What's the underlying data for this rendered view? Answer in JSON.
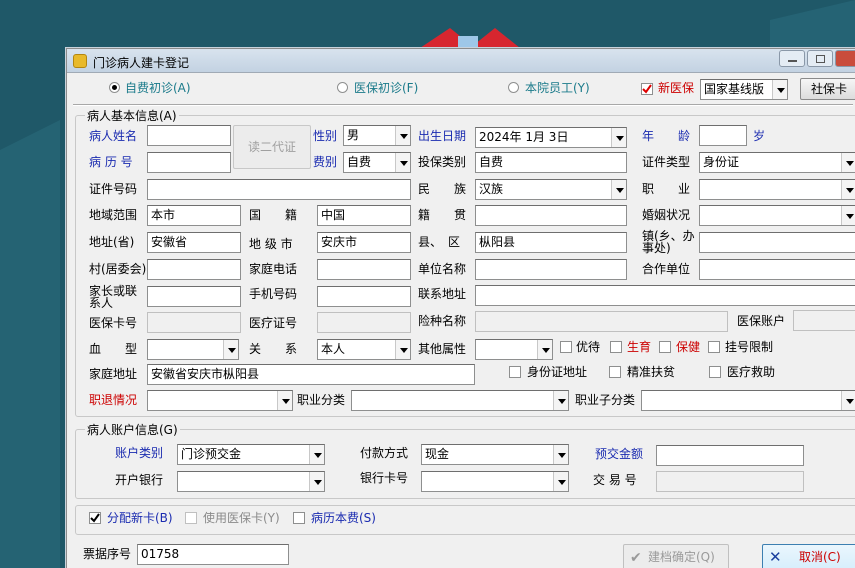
{
  "window": {
    "title": "门诊病人建卡登记"
  },
  "top": {
    "visit_self": "自费初诊(A)",
    "visit_insurance": "医保初诊(F)",
    "visit_staff": "本院员工(Y)",
    "new_insurance_label": "新医保",
    "insurance_version": "国家基线版",
    "social_card_btn": "社保卡"
  },
  "basic": {
    "group_title": "病人基本信息(A)",
    "read_id_btn": "读二代证",
    "name_label": "病人姓名",
    "gender_label": "性别",
    "gender_value": "男",
    "birth_label": "出生日期",
    "birth_value": "2024年 1月 3日",
    "age_label": "年　　龄",
    "age_unit": "岁",
    "record_label": "病 历 号",
    "fee_label": "费别",
    "fee_value": "自费",
    "insure_type_label": "投保类别",
    "insure_type_value": "自费",
    "cert_type_label": "证件类型",
    "cert_type_value": "身份证",
    "cert_no_label": "证件号码",
    "ethnic_label": "民　　族",
    "ethnic_value": "汉族",
    "job_label": "职　　业",
    "region_label": "地域范围",
    "region_value": "本市",
    "nation_label": "国　　籍",
    "nation_value": "中国",
    "origin_label": "籍　　贯",
    "marriage_label": "婚姻状况",
    "province_label": "地址(省)",
    "province_value": "安徽省",
    "city_label": "地 级 市",
    "city_value": "安庆市",
    "county_label": "县、　区",
    "county_value": "枞阳县",
    "town_label": "镇(乡、办事处)",
    "village_label": "村(居委会)",
    "home_phone_label": "家庭电话",
    "work_name_label": "单位名称",
    "coop_label": "合作单位",
    "guardian_label": "家长或联系人",
    "mobile_label": "手机号码",
    "contact_addr_label": "联系地址",
    "ins_card_label": "医保卡号",
    "medical_cert_label": "医疗证号",
    "ins_type_name_label": "险种名称",
    "ins_account_label": "医保账户",
    "blood_label": "血　　型",
    "relation_label": "关　　系",
    "relation_value": "本人",
    "other_attr_label": "其他属性",
    "preferential_label": "优待",
    "birth_ins_label": "生育",
    "health_label": "保健",
    "limit_label": "挂号限制",
    "home_addr_label": "家庭地址",
    "home_addr_value": "安徽省安庆市枞阳县",
    "id_addr_label": "身份证地址",
    "poverty_label": "精准扶贫",
    "aid_label": "医疗救助",
    "retire_label": "职退情况",
    "job_class_label": "职业分类",
    "job_subclass_label": "职业子分类"
  },
  "account": {
    "group_title": "病人账户信息(G)",
    "type_label": "账户类别",
    "type_value": "门诊预交金",
    "pay_label": "付款方式",
    "pay_value": "现金",
    "prepay_label": "预交金额",
    "bank_label": "开户银行",
    "card_label": "银行卡号",
    "trade_label": "交 易 号"
  },
  "bottom": {
    "alloc_card": "分配新卡(B)",
    "use_ins_card": "使用医保卡(Y)",
    "record_fee": "病历本费(S)",
    "bill_label": "票据序号",
    "bill_value": "01758",
    "confirm_btn": "建档确定(Q)",
    "cancel_btn": "取消(C)"
  },
  "colors": {
    "label_blue": "#1a2bb0",
    "label_red": "#cc0000",
    "background": "#1f5868"
  }
}
